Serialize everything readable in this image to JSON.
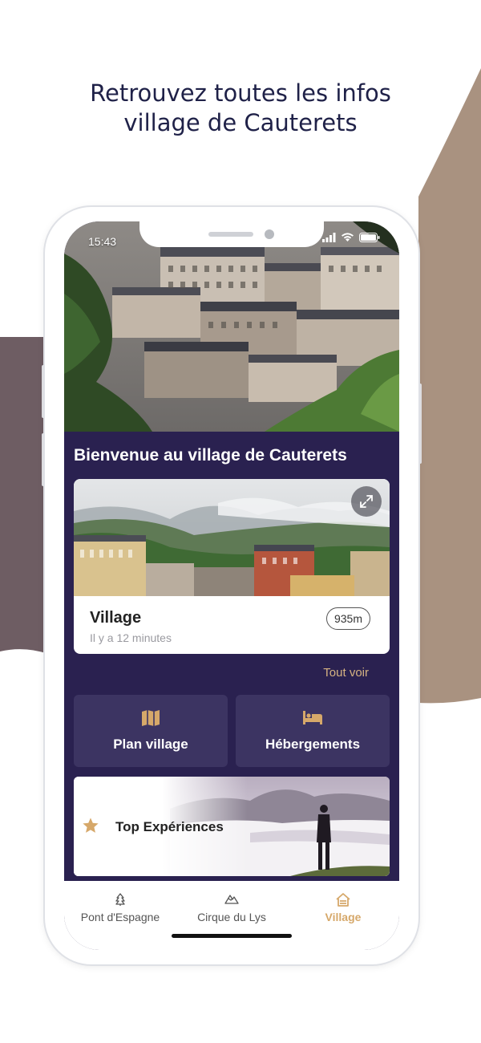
{
  "headline": {
    "line1": "Retrouvez toutes les infos",
    "line2": "village de Cauterets"
  },
  "colors": {
    "navy": "#1f2148",
    "app_background": "#27204a",
    "tile": "#3c3462",
    "accent_gold": "#d6a86a",
    "bg_mauve": "#6e5d63",
    "bg_taupe": "#a99280"
  },
  "status_bar": {
    "time": "15:43",
    "icons": [
      "signal-icon",
      "wifi-icon",
      "battery-icon"
    ]
  },
  "welcome_title": "Bienvenue au village de Cauterets",
  "location_card": {
    "title": "Village",
    "time_ago": "Il y a 12 minutes",
    "distance": "935m",
    "expand_icon": "expand-icon"
  },
  "see_all": "Tout voir",
  "tiles": [
    {
      "label": "Plan village",
      "icon": "map-icon"
    },
    {
      "label": "Hébergements",
      "icon": "bed-icon"
    }
  ],
  "banner": {
    "label": "Top Expériences",
    "icon": "star-icon"
  },
  "tabbar": {
    "tabs": [
      {
        "label": "Pont d'Espagne",
        "icon": "tree-icon",
        "active": false
      },
      {
        "label": "Cirque du Lys",
        "icon": "mountain-icon",
        "active": false
      },
      {
        "label": "Village",
        "icon": "chalet-icon",
        "active": true
      }
    ]
  }
}
